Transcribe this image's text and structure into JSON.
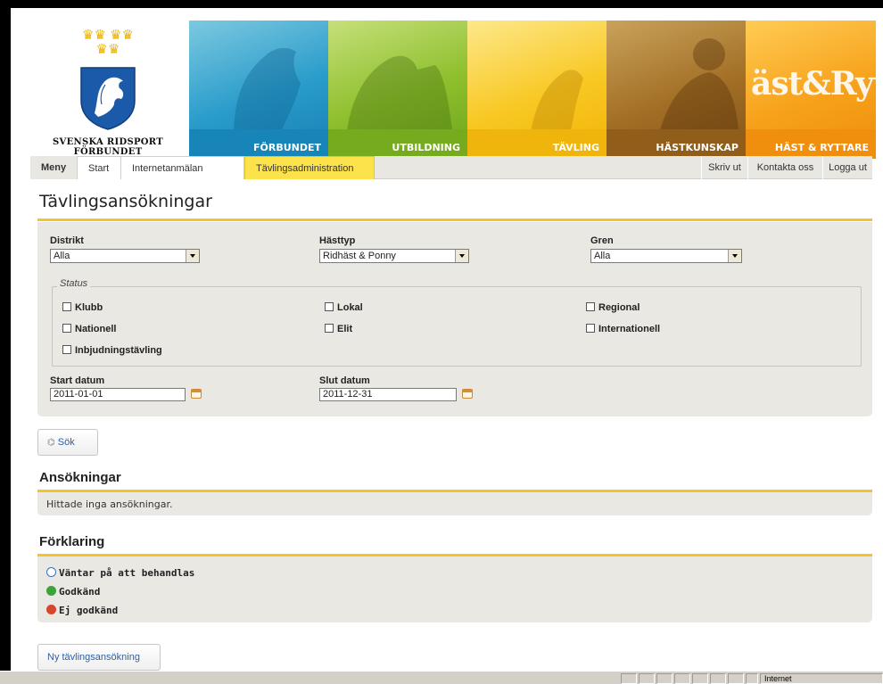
{
  "header": {
    "logo_text_line1": "SVENSKA RIDSPORT",
    "logo_text_line2": "FÖRBUNDET",
    "logo_crowns": "♛♛♛",
    "bands": [
      {
        "label": "FÖRBUNDET",
        "color": "#1785b8"
      },
      {
        "label": "UTBILDNING",
        "color": "#77ab1f"
      },
      {
        "label": "TÄVLING",
        "color": "#efb50d"
      },
      {
        "label": "HÄSTKUNSKAP",
        "color": "#905d1b"
      },
      {
        "label": "HÄST & RYTTARE",
        "color": "#f08e0d"
      }
    ],
    "magazine_script": "äst&Rytt"
  },
  "nav": {
    "menu": "Meny",
    "tabs": [
      "Start",
      "Internetanmälan",
      "Tävlingsadministration"
    ],
    "active_tab": "Tävlingsadministration",
    "right": [
      "Skriv ut",
      "Kontakta oss",
      "Logga ut"
    ]
  },
  "page_title": "Tävlingsansökningar",
  "filters": {
    "distrikt_label": "Distrikt",
    "distrikt_value": "Alla",
    "hasttyp_label": "Hästtyp",
    "hasttyp_value": "Ridhäst & Ponny",
    "gren_label": "Gren",
    "gren_value": "Alla",
    "status_legend": "Status",
    "status_options": [
      "Klubb",
      "Lokal",
      "Regional",
      "Nationell",
      "Elit",
      "Internationell",
      "Inbjudningstävling"
    ],
    "start_label": "Start datum",
    "start_value": "2011-01-01",
    "end_label": "Slut datum",
    "end_value": "2011-12-31"
  },
  "search_button": "Sök",
  "applications": {
    "heading": "Ansökningar",
    "empty_text": "Hittade inga ansökningar."
  },
  "explanation": {
    "heading": "Förklaring",
    "items": [
      {
        "label": "Väntar på att behandlas",
        "icon": "clock-icon",
        "color": "#3a6fc9"
      },
      {
        "label": "Godkänd",
        "icon": "check-icon",
        "color": "#3aa33a"
      },
      {
        "label": "Ej godkänd",
        "icon": "stop-icon",
        "color": "#d9452a"
      }
    ]
  },
  "new_button": "Ny tävlingsansökning",
  "statusbar": {
    "zone": "Internet"
  },
  "colors": {
    "accent": "#f4c42d",
    "panel": "#e9e8e3",
    "link": "#2b5fab"
  }
}
